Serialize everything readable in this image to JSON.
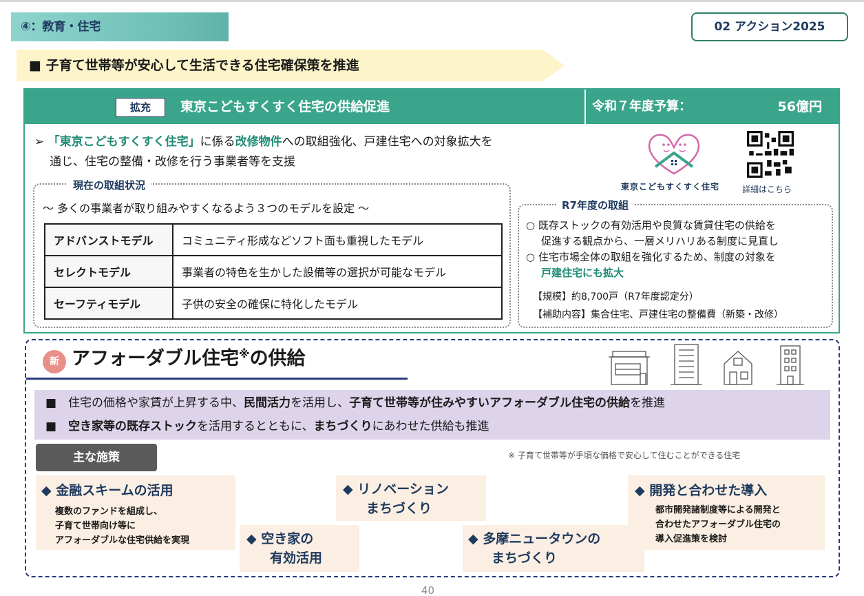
{
  "section_tab": "④：教育・住宅",
  "action_badge": "02 アクション2025",
  "headline": "■ 子育て世帯等が安心して生活できる住宅確保策を推進",
  "supply": {
    "tag": "拡充",
    "title": "東京こどもすくすく住宅の供給促進",
    "budget_label": "令和７年度予算：",
    "budget_value": "56億円",
    "bullet_marker": "➢",
    "bullet_q1": "「東京こどもすくすく住宅」",
    "bullet_t1": "に係る",
    "bullet_b1": "改修物件",
    "bullet_t2": "への取組強化、戸建住宅への対象拡大を",
    "bullet_line2": "通じ、住宅の整備・改修を行う事業者等を支援",
    "logo_caption": "東京こどもすくすく住宅",
    "qr_caption": "詳細はこちら",
    "current_label": "現在の取組状況",
    "current_sub": "～ 多くの事業者が取り組みやすくなるよう３つのモデルを設定 ～",
    "models": [
      {
        "name": "アドバンストモデル",
        "desc": "コミュニティ形成などソフト面も重視したモデル"
      },
      {
        "name": "セレクトモデル",
        "desc": "事業者の特色を生かした設備等の選択が可能なモデル"
      },
      {
        "name": "セーフティモデル",
        "desc": "子供の安全の確保に特化したモデル"
      }
    ],
    "r7_label": "R7年度の取組",
    "r7_l1": "○ 既存ストックの有効活用や良質な賃貸住宅の供給を",
    "r7_l2": "促進する観点から、一層メリハリある制度に見直し",
    "r7_l3": "○ 住宅市場全体の取組を強化するため、制度の対象を",
    "r7_l4": "戸建住宅にも拡大",
    "scale": "【規模】約8,700戸（R7年度認定分）",
    "subsidy": "【補助内容】集合住宅、戸建住宅の整備費（新築・改修）"
  },
  "affordable": {
    "new_badge": "新",
    "title": "アフォーダブル住宅",
    "title_mark": "※",
    "title_suffix": "の供給",
    "p1_a": "■　住宅の価格や家賃が上昇する中、",
    "p1_b": "民間活力",
    "p1_c": "を活用し、",
    "p1_d": "子育て世帯等が住みやすいアフォーダブル住宅の供給",
    "p1_e": "を推進",
    "p2_a": "■　",
    "p2_b": "空き家等の既存ストック",
    "p2_c": "を活用するとともに、",
    "p2_d": "まちづくり",
    "p2_e": "にあわせた供給も推進",
    "measures_label": "主な施策",
    "note": "※ 子育て世帯等が手頃な価格で安心して住むことができる住宅",
    "cards": [
      {
        "title": "金融スキームの活用",
        "body": [
          "複数のファンドを組成し、",
          "子育て世帯向け等に",
          "アフォーダブルな住宅供給を実現"
        ]
      },
      {
        "title": "空き家の",
        "title2": "有効活用"
      },
      {
        "title": "リノベーション",
        "title2": "まちづくり"
      },
      {
        "title": "多摩ニュータウンの",
        "title2": "まちづくり"
      },
      {
        "title": "開発と合わせた導入",
        "body": [
          "都市開発諸制度等による開発と",
          "合わせたアフォーダブル住宅の",
          "導入促進策を検討"
        ]
      }
    ],
    "diamond": "◆"
  },
  "page_number": "40",
  "colors": {
    "teal": "#3aa58a",
    "navy": "#1e3a5f",
    "purple_band": "#ddd3ea",
    "card": "#fbeee2"
  }
}
